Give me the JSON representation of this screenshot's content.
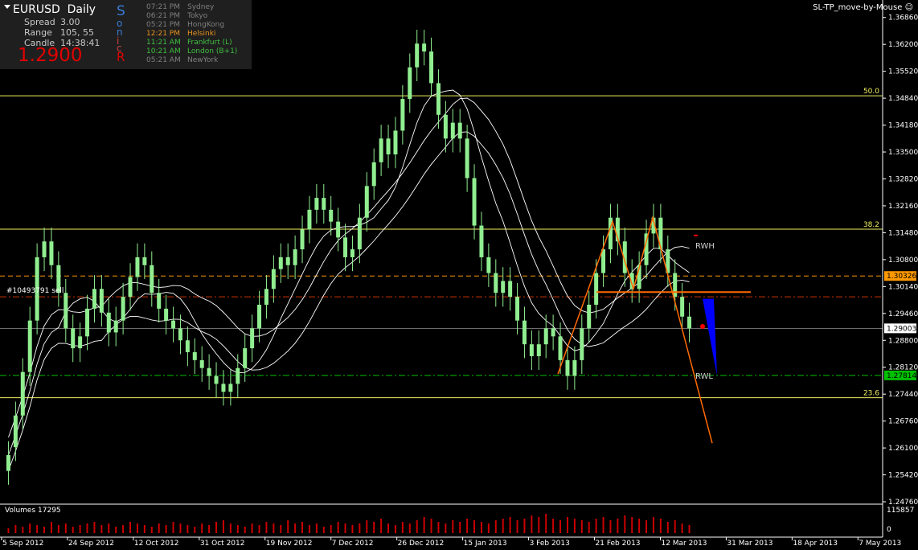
{
  "symbol": "EURUSD",
  "timeframe": "Daily",
  "indicator_title": "SL-TP_move-by-Mouse",
  "info": {
    "spread_label": "Spread",
    "spread_value": "3.00",
    "range_label": "Range",
    "range_value": "105, 55",
    "candle_label": "Candle",
    "candle_value": "14:38:41",
    "price": "1.2900"
  },
  "sonic_letters": [
    "S",
    "o",
    "n",
    "i",
    "c",
    "R"
  ],
  "sessions": [
    {
      "time": "07:21 PM",
      "city": "Sydney",
      "color": "#7f7f7f"
    },
    {
      "time": "06:21 PM",
      "city": "Tokyo",
      "color": "#7f7f7f"
    },
    {
      "time": "05:21 PM",
      "city": "HongKong",
      "color": "#7f7f7f"
    },
    {
      "time": "12:21 PM",
      "city": "Helsinki",
      "color": "#e8921c"
    },
    {
      "time": "11:21 AM",
      "city": "Frankfurt  (L)",
      "color": "#3fbf3f"
    },
    {
      "time": "10:21 AM",
      "city": "London  (B+1)",
      "color": "#3fbf3f"
    },
    {
      "time": "05:21 AM",
      "city": "NewYork",
      "color": "#7f7f7f"
    }
  ],
  "colors": {
    "candle": "#90ee90",
    "level_line": "#f0f060",
    "pattern": "#ff6a00",
    "tp_arrow": "#0000ff",
    "grid_text": "#ffffff",
    "volume": "#cc0000"
  },
  "order_label": "#10493791 sell",
  "rwh_label": "RWH",
  "rwl_label": "RWL",
  "volumes_label": "Volumes 17295",
  "chart_data": {
    "type": "candlestick",
    "ylim": [
      1.246,
      1.372
    ],
    "price_ticks": [
      "1.36860",
      "1.36200",
      "1.35520",
      "1.34840",
      "1.34180",
      "1.33500",
      "1.32820",
      "1.32160",
      "1.31480",
      "1.30800",
      "1.30140",
      "1.29460",
      "1.28800",
      "1.28120",
      "1.27440",
      "1.26760",
      "1.26100",
      "1.25420",
      "1.24760"
    ],
    "time_ticks": [
      "5 Sep 2012",
      "24 Sep 2012",
      "12 Oct 2012",
      "31 Oct 2012",
      "19 Nov 2012",
      "7 Dec 2012",
      "26 Dec 2012",
      "15 Jan 2013",
      "3 Feb 2013",
      "21 Feb 2013",
      "12 Mar 2013",
      "31 Mar 2013",
      "18 Apr 2013",
      "7 May 2013"
    ],
    "fib_levels": [
      {
        "label": "50.0",
        "price": 1.3488
      },
      {
        "label": "38.2",
        "price": 1.3151
      },
      {
        "label": "23.6",
        "price": 1.2725
      }
    ],
    "price_tags": [
      {
        "text": "1.30326",
        "price": 1.30326,
        "bg": "#ff9900",
        "fg": "#000000"
      },
      {
        "text": "1.29003",
        "price": 1.29003,
        "bg": "#ffffff",
        "fg": "#000000"
      },
      {
        "text": "1.27814",
        "price": 1.27814,
        "bg": "#00c000",
        "fg": "#000000"
      }
    ],
    "close_path": [
      [
        1.254,
        1.258
      ],
      [
        1.26,
        1.268
      ],
      [
        1.268,
        1.279
      ],
      [
        1.279,
        1.292
      ],
      [
        1.292,
        1.308
      ],
      [
        1.308,
        1.312
      ],
      [
        1.312,
        1.306
      ],
      [
        1.306,
        1.299
      ],
      [
        1.299,
        1.29
      ],
      [
        1.29,
        1.285
      ],
      [
        1.285,
        1.288
      ],
      [
        1.288,
        1.295
      ],
      [
        1.295,
        1.3
      ],
      [
        1.3,
        1.294
      ],
      [
        1.294,
        1.289
      ],
      [
        1.289,
        1.292
      ],
      [
        1.292,
        1.298
      ],
      [
        1.298,
        1.303
      ],
      [
        1.303,
        1.308
      ],
      [
        1.308,
        1.306
      ],
      [
        1.306,
        1.299
      ],
      [
        1.299,
        1.295
      ],
      [
        1.295,
        1.292
      ],
      [
        1.292,
        1.29
      ],
      [
        1.29,
        1.287
      ],
      [
        1.287,
        1.284
      ],
      [
        1.284,
        1.282
      ],
      [
        1.282,
        1.28
      ],
      [
        1.28,
        1.278
      ],
      [
        1.278,
        1.276
      ],
      [
        1.276,
        1.274
      ],
      [
        1.274,
        1.276
      ],
      [
        1.276,
        1.28
      ],
      [
        1.28,
        1.285
      ],
      [
        1.285,
        1.29
      ],
      [
        1.29,
        1.296
      ],
      [
        1.296,
        1.3
      ],
      [
        1.3,
        1.305
      ],
      [
        1.305,
        1.308
      ],
      [
        1.308,
        1.306
      ],
      [
        1.306,
        1.31
      ],
      [
        1.31,
        1.315
      ],
      [
        1.315,
        1.32
      ],
      [
        1.32,
        1.323
      ],
      [
        1.323,
        1.32
      ],
      [
        1.32,
        1.317
      ],
      [
        1.317,
        1.313
      ],
      [
        1.313,
        1.308
      ],
      [
        1.308,
        1.31
      ],
      [
        1.31,
        1.318
      ],
      [
        1.318,
        1.326
      ],
      [
        1.326,
        1.332
      ],
      [
        1.332,
        1.338
      ],
      [
        1.338,
        1.334
      ],
      [
        1.334,
        1.34
      ],
      [
        1.34,
        1.348
      ],
      [
        1.348,
        1.356
      ],
      [
        1.356,
        1.362
      ],
      [
        1.362,
        1.36
      ],
      [
        1.36,
        1.352
      ],
      [
        1.352,
        1.344
      ],
      [
        1.344,
        1.338
      ],
      [
        1.338,
        1.342
      ],
      [
        1.342,
        1.338
      ],
      [
        1.338,
        1.328
      ],
      [
        1.328,
        1.316
      ],
      [
        1.316,
        1.308
      ],
      [
        1.308,
        1.304
      ],
      [
        1.304,
        1.299
      ],
      [
        1.299,
        1.302
      ],
      [
        1.302,
        1.298
      ],
      [
        1.298,
        1.292
      ],
      [
        1.292,
        1.286
      ],
      [
        1.286,
        1.283
      ],
      [
        1.283,
        1.286
      ],
      [
        1.286,
        1.29
      ],
      [
        1.29,
        1.288
      ],
      [
        1.288,
        1.282
      ],
      [
        1.282,
        1.278
      ],
      [
        1.278,
        1.282
      ],
      [
        1.282,
        1.29
      ],
      [
        1.29,
        1.296
      ],
      [
        1.296,
        1.304
      ],
      [
        1.304,
        1.31
      ],
      [
        1.31,
        1.318
      ],
      [
        1.318,
        1.312
      ],
      [
        1.312,
        1.304
      ],
      [
        1.304,
        1.3
      ],
      [
        1.3,
        1.306
      ],
      [
        1.306,
        1.314
      ],
      [
        1.314,
        1.318
      ],
      [
        1.318,
        1.31
      ],
      [
        1.31,
        1.304
      ],
      [
        1.304,
        1.298
      ],
      [
        1.298,
        1.293
      ],
      [
        1.293,
        1.29
      ]
    ],
    "volume_heights": [
      3,
      5,
      4,
      6,
      5,
      4,
      7,
      5,
      6,
      4,
      5,
      6,
      7,
      5,
      6,
      4,
      5,
      7,
      6,
      5,
      4,
      6,
      5,
      7,
      6,
      5,
      4,
      6,
      5,
      7,
      8,
      6,
      5,
      4,
      6,
      5,
      7,
      6,
      5,
      8,
      6,
      7,
      5,
      6,
      4,
      5,
      7,
      6,
      5,
      6,
      8,
      7,
      9,
      6,
      5,
      7,
      6,
      8,
      10,
      9,
      7,
      6,
      8,
      7,
      9,
      8,
      7,
      6,
      8,
      9,
      10,
      8,
      9,
      11,
      10,
      12,
      9,
      8,
      10,
      9,
      8,
      7,
      9,
      10,
      8,
      9,
      11,
      10,
      9,
      8,
      10,
      9,
      7,
      8,
      6,
      5
    ]
  }
}
